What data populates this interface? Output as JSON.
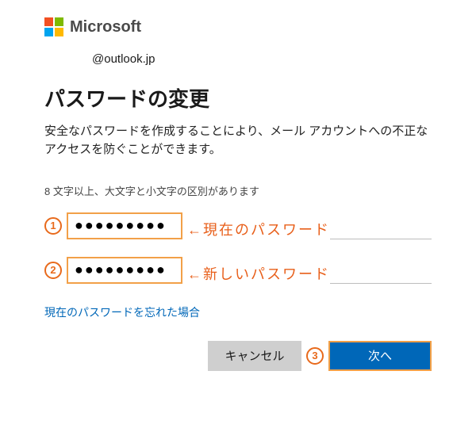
{
  "brand": {
    "name": "Microsoft"
  },
  "account": "@outlook.jp",
  "title": "パスワードの変更",
  "description": "安全なパスワードを作成することにより、メール アカウントへの不正なアクセスを防ぐことができます。",
  "hint": "8 文字以上、大文字と小文字の区別があります",
  "fields": {
    "current": {
      "value": "●●●●●●●●●",
      "callout": "←現在のパスワード",
      "marker": "①"
    },
    "new": {
      "value": "●●●●●●●●●",
      "callout": "←新しいパスワード",
      "marker": "②"
    }
  },
  "forgot": "現在のパスワードを忘れた場合",
  "buttons": {
    "cancel": "キャンセル",
    "next": "次へ",
    "next_marker": "③"
  },
  "colors": {
    "accent": "#0067b8",
    "highlight_border": "#f2a048",
    "annotation": "#e85f1a"
  }
}
